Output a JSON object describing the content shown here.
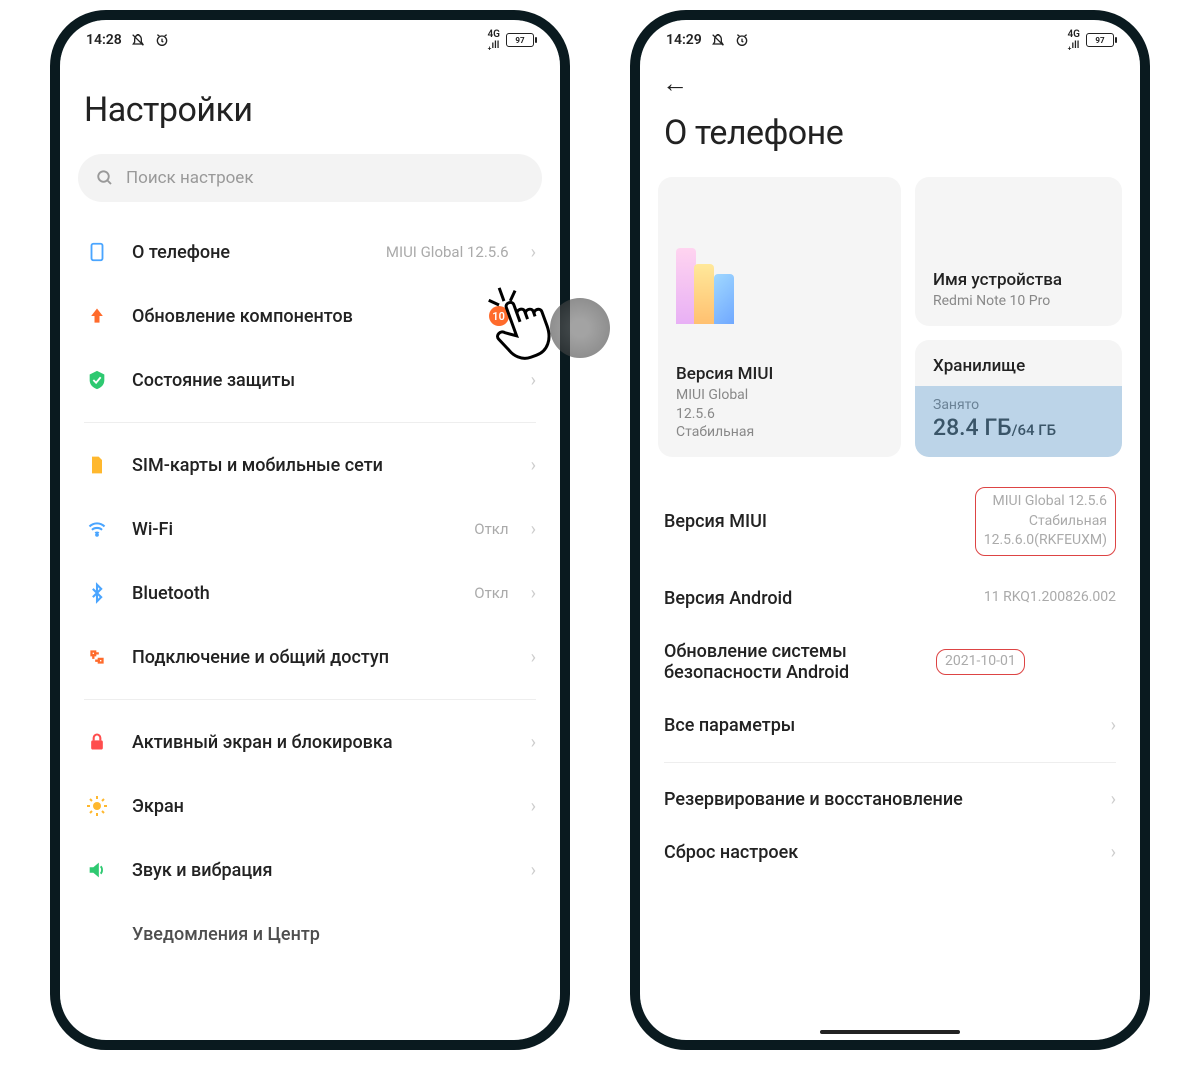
{
  "left": {
    "status": {
      "time": "14:28",
      "battery": "97"
    },
    "title": "Настройки",
    "search": {
      "placeholder": "Поиск настроек"
    },
    "items": {
      "about": {
        "label": "О телефоне",
        "value": "MIUI Global 12.5.6"
      },
      "updates": {
        "label": "Обновление компонентов",
        "badge": "10"
      },
      "security": {
        "label": "Состояние защиты"
      },
      "sim": {
        "label": "SIM-карты и мобильные сети"
      },
      "wifi": {
        "label": "Wi-Fi",
        "value": "Откл"
      },
      "bt": {
        "label": "Bluetooth",
        "value": "Откл"
      },
      "share": {
        "label": "Подключение и общий доступ"
      },
      "lock": {
        "label": "Активный экран и блокировка"
      },
      "display": {
        "label": "Экран"
      },
      "sound": {
        "label": "Звук и вибрация"
      },
      "notif": {
        "label": "Уведомления и Центр"
      }
    }
  },
  "right": {
    "status": {
      "time": "14:29",
      "battery": "97"
    },
    "title": "О телефоне",
    "miui_card": {
      "title": "Версия MIUI",
      "line1": "MIUI Global",
      "line2": "12.5.6",
      "line3": "Стабильная"
    },
    "device_card": {
      "title": "Имя устройства",
      "sub": "Redmi Note 10 Pro"
    },
    "storage_card": {
      "title": "Хранилище",
      "used_label": "Занято",
      "used": "28.4 ГБ",
      "total": "/64 ГБ"
    },
    "rows": {
      "miui": {
        "label": "Версия MIUI",
        "v1": "MIUI Global 12.5.6",
        "v2": "Стабильная",
        "v3": "12.5.6.0(RKFEUXM)"
      },
      "android": {
        "label": "Версия Android",
        "value": "11 RKQ1.200826.002"
      },
      "secpatch": {
        "label": "Обновление системы безопасности Android",
        "value": "2021-10-01"
      },
      "allparams": {
        "label": "Все параметры"
      },
      "backup": {
        "label": "Резервирование и восстановление"
      },
      "reset": {
        "label": "Сброс настроек"
      }
    }
  }
}
